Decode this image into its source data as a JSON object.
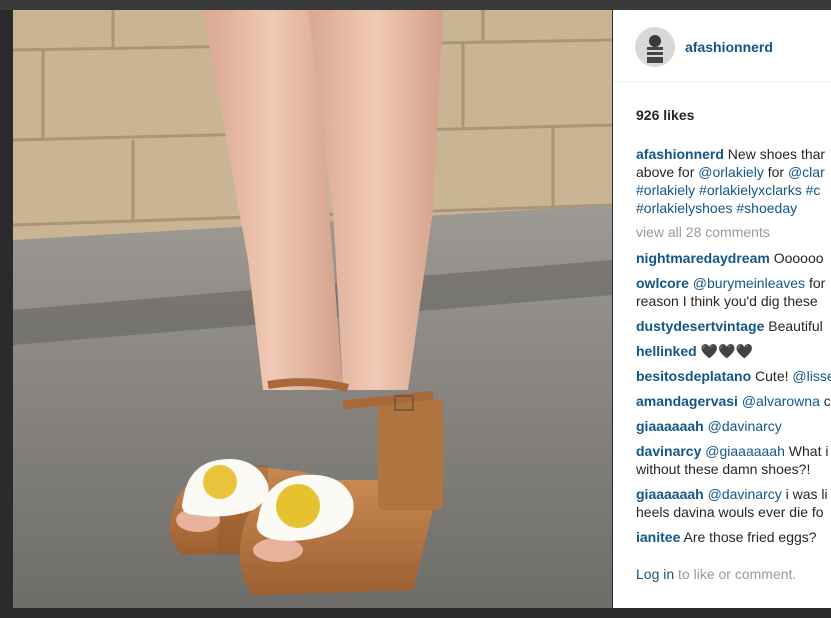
{
  "post": {
    "username": "afashionnerd",
    "likes": "926 likes",
    "caption": {
      "user": "afashionnerd",
      "line1_text": "New shoes thar",
      "line2_pre": "above for ",
      "line2_mention1": "@orlakiely",
      "line2_mid": " for ",
      "line2_mention2": "@clar",
      "line3": "#orlakiely #orlakielyxclarks #c",
      "line4": "#orlakielyshoes #shoeday"
    },
    "view_all": "view all 28 comments",
    "comments": [
      {
        "user": "nightmaredaydream",
        "text": " Oooooo",
        "mention": "",
        "line2": ""
      },
      {
        "user": "owlcore",
        "mention": " @burymeinleaves",
        "text": " for",
        "line2": "reason I think you'd dig these"
      },
      {
        "user": "dustydesertvintage",
        "text": " Beautiful",
        "mention": "",
        "line2": ""
      },
      {
        "user": "hellinked",
        "text": " 🖤🖤🖤",
        "mention": "",
        "line2": ""
      },
      {
        "user": "besitosdeplatano",
        "text": " Cute! ",
        "mention": "@lisse",
        "line2": ""
      },
      {
        "user": "amandagervasi",
        "mention": " @alvarowna",
        "text": " c",
        "line2": ""
      },
      {
        "user": "giaaaaaah",
        "mention": " @davinarcy",
        "text": "",
        "line2": ""
      },
      {
        "user": "davinarcy",
        "mention": " @giaaaaaah",
        "text": " What i",
        "line2": "without these damn shoes?!"
      },
      {
        "user": "giaaaaaah",
        "mention": " @davinarcy",
        "text": " i was li",
        "line2": "heels davina wouls ever die fo"
      },
      {
        "user": "ianitee",
        "text": " Are those fried eggs?",
        "mention": "",
        "line2": ""
      }
    ],
    "login": {
      "link": "Log in",
      "rest": " to like or comment."
    }
  }
}
